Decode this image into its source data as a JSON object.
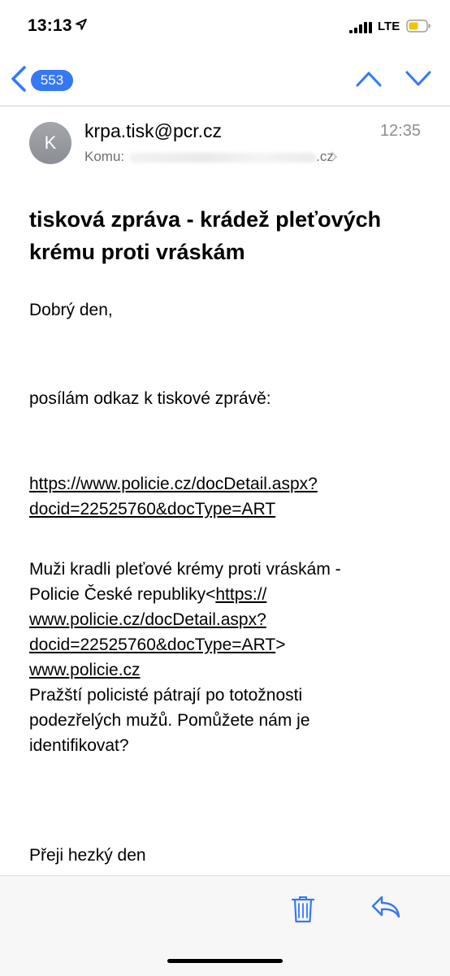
{
  "status_bar": {
    "time": "13:13",
    "network": "LTE",
    "location_icon": "location-arrow-icon",
    "battery_color": "#f5c400"
  },
  "nav": {
    "back_icon": "chevron-left-icon",
    "unread_count": "553",
    "prev_icon": "chevron-up-icon",
    "next_icon": "chevron-down-icon",
    "accent_color": "#3478f6"
  },
  "message": {
    "avatar_initial": "K",
    "sender": "krpa.tisk@pcr.cz",
    "time": "12:35",
    "recipient_label": "Komu:",
    "recipient_tail": ".cz",
    "subject": "tisková zpráva - krádež pleťových krému proti vráskám",
    "greeting": "Dobrý den,",
    "intro": "posílám odkaz k tiskové zprávě:",
    "link_line1": "https://www.policie.cz/docDetail.aspx?",
    "link_line2": "docid=22525760&docType=ART",
    "article_title_line1": "Muži kradli pleťové krémy proti vráskám -",
    "article_title_line2_prefix": "Policie České republiky<",
    "article_title_link1": "https://",
    "article_link_line2": "www.policie.cz/docDetail.aspx?",
    "article_link_line3": "docid=22525760&docType=ART",
    "article_link_suffix": ">",
    "site_link": "www.policie.cz",
    "summary_line1": "Pražští policisté pátrají po totožnosti",
    "summary_line2": "podezřelých mužů. Pomůžete nám je",
    "summary_line3": "identifikovat?",
    "closing": "Přeji hezký den"
  },
  "toolbar": {
    "trash_icon": "trash-icon",
    "reply_icon": "reply-icon"
  }
}
